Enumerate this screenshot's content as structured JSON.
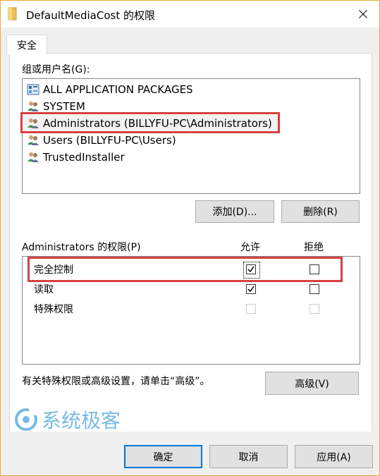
{
  "window": {
    "title": "DefaultMediaCost 的权限",
    "icon": "folder-icon",
    "border_color": "#f0a830"
  },
  "tabs": [
    {
      "label": "安全"
    }
  ],
  "groups": {
    "label": "组或用户名(G):",
    "items": [
      {
        "label": "ALL APPLICATION PACKAGES",
        "icon": "app-packages-icon"
      },
      {
        "label": "SYSTEM",
        "icon": "users-icon"
      },
      {
        "label": "Administrators (BILLYFU-PC\\Administrators)",
        "icon": "users-icon",
        "selected": true
      },
      {
        "label": "Users (BILLYFU-PC\\Users)",
        "icon": "users-icon"
      },
      {
        "label": "TrustedInstaller",
        "icon": "users-icon"
      }
    ],
    "add_label": "添加(D)...",
    "remove_label": "删除(R)"
  },
  "permissions": {
    "label": "Administrators 的权限(P)",
    "allow_header": "允许",
    "deny_header": "拒绝",
    "rows": [
      {
        "name": "完全控制",
        "allow": true,
        "deny": false,
        "enabled": true
      },
      {
        "name": "读取",
        "allow": true,
        "deny": false,
        "enabled": true
      },
      {
        "name": "特殊权限",
        "allow": false,
        "deny": false,
        "enabled": false
      }
    ]
  },
  "advanced": {
    "text": "有关特殊权限或高级设置，请单击“高级”。",
    "button_label": "高级(V)"
  },
  "watermark": {
    "text": "系统极客"
  },
  "footer": {
    "ok_label": "确定",
    "cancel_label": "取消",
    "apply_label": "应用(A)"
  },
  "colors": {
    "highlight": "#d84040",
    "accent": "#0078d7",
    "watermark": "#4aa3df"
  }
}
